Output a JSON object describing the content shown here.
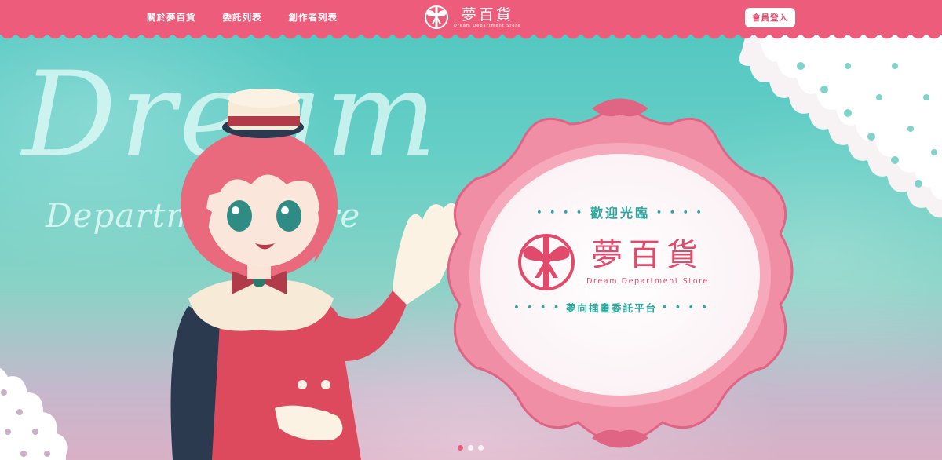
{
  "header": {
    "nav": [
      {
        "label": "關於夢百貨"
      },
      {
        "label": "委託列表"
      },
      {
        "label": "創作者列表"
      }
    ],
    "brand": {
      "name": "夢百貨",
      "subtitle": "Dream Department Store"
    },
    "login_label": "會員登入"
  },
  "hero": {
    "background_script": "Dream",
    "background_script_sub": "Department Store",
    "frame": {
      "welcome": "歡迎光臨",
      "dots": "• • • •",
      "name": "夢百貨",
      "subtitle": "Dream Department Store",
      "tagline": "夢向插畫委託平台"
    },
    "carousel": {
      "count": 3,
      "active_index": 0
    }
  },
  "colors": {
    "primary_pink": "#ee5c7b",
    "accent_pink": "#e14a6b",
    "teal": "#2aa79d",
    "background_teal": "#5ec9c2"
  }
}
